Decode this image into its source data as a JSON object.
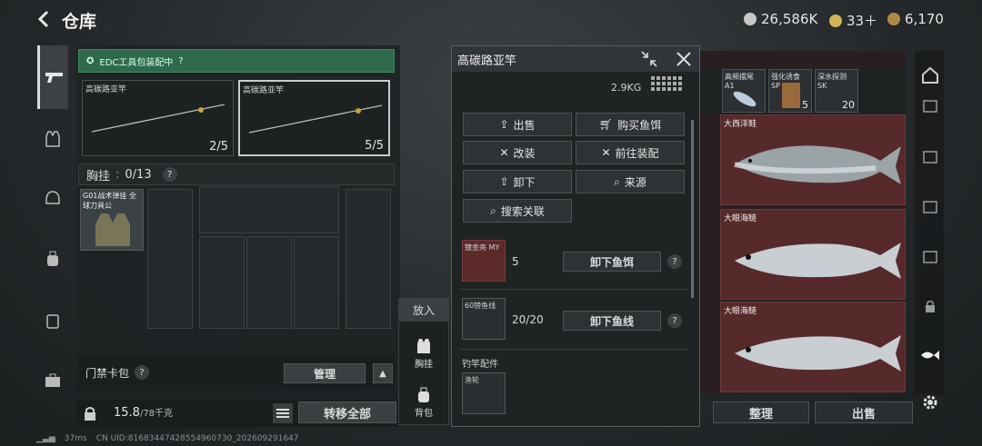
{
  "header": {
    "title": "仓库",
    "currencies": [
      {
        "icon": "silver-coin-icon",
        "value": "26,586K",
        "color": "#c8c8c8"
      },
      {
        "icon": "gold-coin-icon",
        "value": "33＋",
        "color": "#d6b25a"
      },
      {
        "icon": "bronze-coin-icon",
        "value": "6,170",
        "color": "#b08a45"
      }
    ]
  },
  "left_panel": {
    "edc_text": "EDC工具包装配中",
    "edc_hint": "?",
    "rod_slots": [
      {
        "label": "高碳路亚竿",
        "count": "2/5"
      },
      {
        "label": "高碳路亚竿",
        "count": "5/5"
      }
    ],
    "chest_label": "胸挂",
    "chest_count": "0/13",
    "chest_item_label": "G01战术弹挂 全球刀具公",
    "keycard_label": "门禁卡包",
    "manage_label": "管理",
    "weight_value": "15.8",
    "weight_max": "/78千克",
    "transfer_all_label": "转移全部"
  },
  "put_into": {
    "title": "放入",
    "items": [
      {
        "label": "胸挂",
        "icon": "vest-icon"
      },
      {
        "label": "背包",
        "icon": "backpack-icon"
      }
    ]
  },
  "popup": {
    "title": "高碳路亚竿",
    "weight": "2.9KG",
    "actions": [
      {
        "label": "出售",
        "icon": "sell-icon"
      },
      {
        "label": "购买鱼饵",
        "icon": "cart-icon"
      },
      {
        "label": "改装",
        "icon": "tools-icon"
      },
      {
        "label": "前往装配",
        "icon": "tools-icon"
      },
      {
        "label": "卸下",
        "icon": "unload-icon"
      },
      {
        "label": "来源",
        "icon": "search-icon"
      },
      {
        "label": "搜索关联",
        "icon": "search-icon"
      }
    ],
    "bait": {
      "thumb": "镀金亮 MY",
      "count": "5",
      "button": "卸下鱼饵"
    },
    "line": {
      "thumb": "60镑鱼线",
      "count": "20/20",
      "button": "卸下鱼线"
    },
    "parts_label": "钓竿配件",
    "reel_thumb": "渔轮"
  },
  "stash": {
    "top_items": [
      {
        "label": "高频摆尾 A1",
        "count": ""
      },
      {
        "label": "强化诱食 SP",
        "count": "5"
      },
      {
        "label": "深水探测 SK",
        "count": "20"
      }
    ],
    "fish": [
      {
        "label": "大西洋鲑"
      },
      {
        "label": "大眼海鲢"
      },
      {
        "label": "大眼海鲢"
      }
    ],
    "sort_label": "整理",
    "sell_label": "出售"
  },
  "status": {
    "ping": "37ms",
    "uid": "CN UID:81683447428554960730_202609291647"
  }
}
